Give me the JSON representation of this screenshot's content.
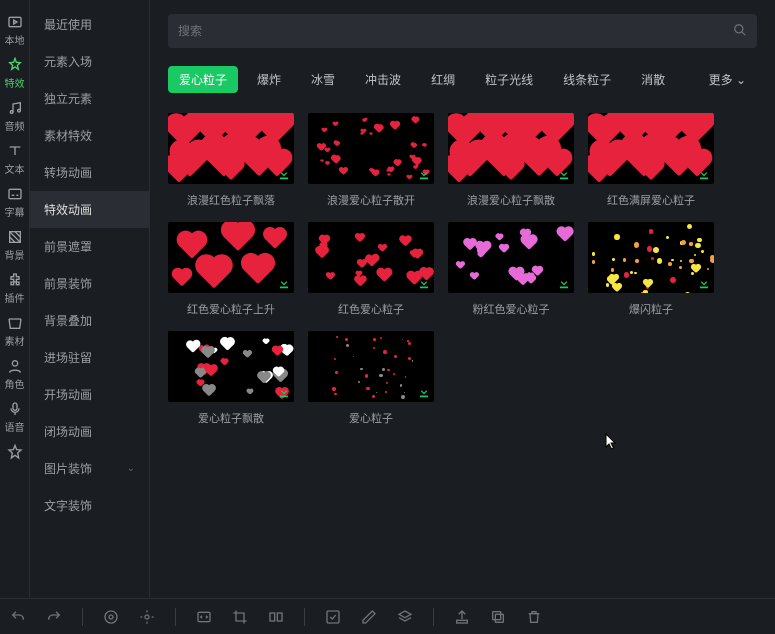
{
  "sidebar_icons": [
    {
      "id": "local",
      "label": "本地"
    },
    {
      "id": "effects",
      "label": "特效",
      "active": true
    },
    {
      "id": "audio",
      "label": "音频"
    },
    {
      "id": "text",
      "label": "文本"
    },
    {
      "id": "subtitle",
      "label": "字幕"
    },
    {
      "id": "background",
      "label": "背景"
    },
    {
      "id": "plugin",
      "label": "插件"
    },
    {
      "id": "material",
      "label": "素材"
    },
    {
      "id": "character",
      "label": "角色"
    },
    {
      "id": "voice",
      "label": "语音"
    },
    {
      "id": "favorite",
      "label": ""
    }
  ],
  "categories": [
    {
      "id": "recent",
      "label": "最近使用"
    },
    {
      "id": "enter",
      "label": "元素入场"
    },
    {
      "id": "indep",
      "label": "独立元素"
    },
    {
      "id": "matfx",
      "label": "素材特效"
    },
    {
      "id": "trans",
      "label": "转场动画"
    },
    {
      "id": "fxanim",
      "label": "特效动画",
      "active": true
    },
    {
      "id": "fgmask",
      "label": "前景遮罩"
    },
    {
      "id": "fgdeco",
      "label": "前景装饰"
    },
    {
      "id": "bgover",
      "label": "背景叠加"
    },
    {
      "id": "stay",
      "label": "进场驻留"
    },
    {
      "id": "openani",
      "label": "开场动画"
    },
    {
      "id": "closeani",
      "label": "闭场动画"
    },
    {
      "id": "picdeco",
      "label": "图片装饰",
      "expandable": true
    },
    {
      "id": "textdeco",
      "label": "文字装饰"
    }
  ],
  "search": {
    "placeholder": "搜索"
  },
  "tags": [
    {
      "id": "heart",
      "label": "爱心粒子",
      "active": true
    },
    {
      "id": "explode",
      "label": "爆炸"
    },
    {
      "id": "snow",
      "label": "冰雪"
    },
    {
      "id": "shock",
      "label": "冲击波"
    },
    {
      "id": "ribbon",
      "label": "红绸"
    },
    {
      "id": "light",
      "label": "粒子光线"
    },
    {
      "id": "line",
      "label": "线条粒子"
    },
    {
      "id": "dissipate",
      "label": "消散"
    }
  ],
  "more_label": "更多",
  "items": [
    {
      "id": "t1",
      "title": "浪漫红色粒子飘落",
      "style": "dense-red"
    },
    {
      "id": "t2",
      "title": "浪漫爱心粒子散开",
      "style": "scatter-red"
    },
    {
      "id": "t3",
      "title": "浪漫爱心粒子飘散",
      "style": "dense-red"
    },
    {
      "id": "t4",
      "title": "红色满屏爱心粒子",
      "style": "dense-red"
    },
    {
      "id": "t5",
      "title": "红色爱心粒子上升",
      "style": "rise-red"
    },
    {
      "id": "t6",
      "title": "红色爱心粒子",
      "style": "small-red"
    },
    {
      "id": "t7",
      "title": "粉红色爱心粒子",
      "style": "pink"
    },
    {
      "id": "t8",
      "title": "爆闪粒子",
      "style": "yellow"
    },
    {
      "id": "t9",
      "title": "爱心粒子飘散",
      "style": "mixed"
    },
    {
      "id": "t10",
      "title": "爱心粒子",
      "style": "tiny-red"
    }
  ]
}
